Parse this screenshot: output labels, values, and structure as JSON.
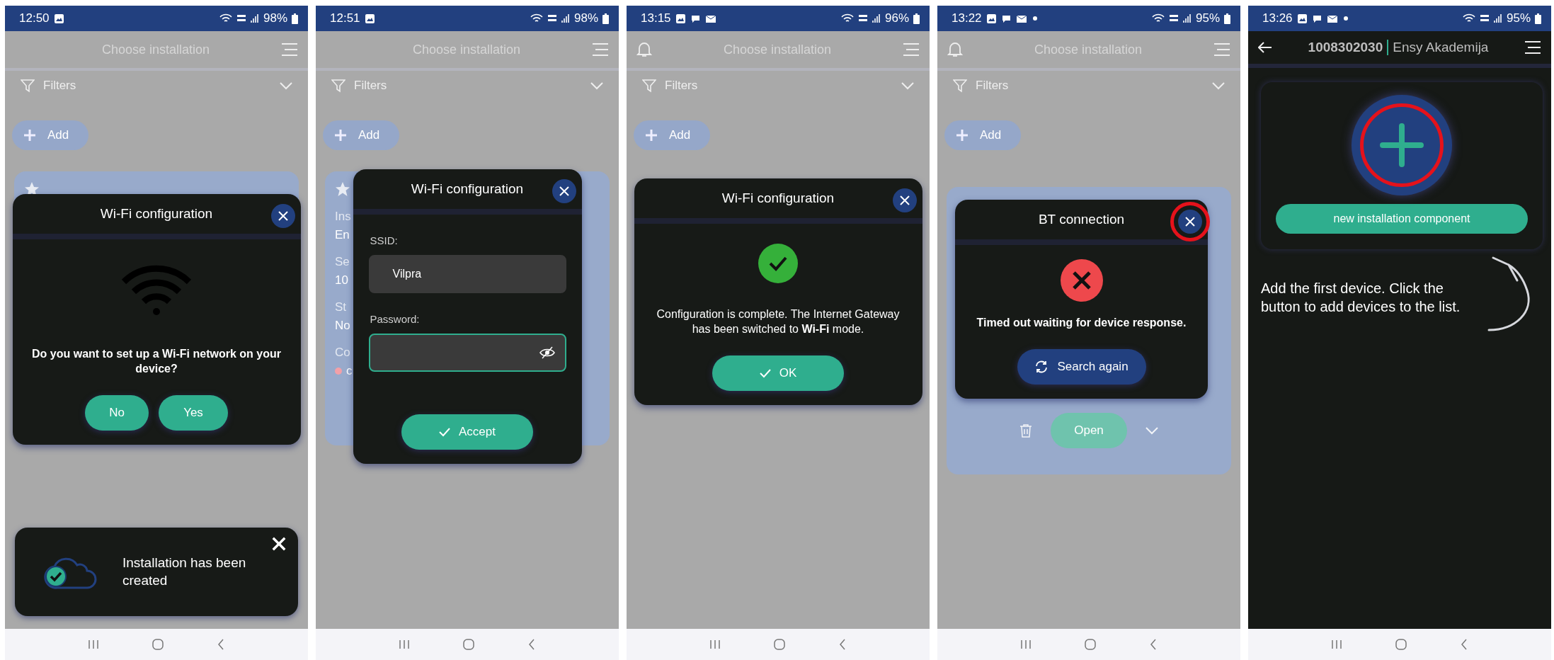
{
  "screens": [
    {
      "kind": "list",
      "status": {
        "time": "12:50",
        "icons": [
          {
            "kind": "image"
          }
        ],
        "battery": "98%"
      },
      "header": {
        "title": "Choose installation",
        "bell": false
      },
      "filters": {
        "label": "Filters"
      },
      "add": {
        "label": "Add"
      },
      "card": {
        "star": true
      },
      "dialog": {
        "kind": "question",
        "title": "Wi-Fi configuration",
        "close_highlighted": false,
        "message": "Do you want to set up a Wi-Fi network on your device?",
        "buttons": [
          "No",
          "Yes"
        ]
      },
      "toast": {
        "message": "Installation has been created"
      }
    },
    {
      "kind": "list",
      "status": {
        "time": "12:51",
        "icons": [
          {
            "kind": "image"
          }
        ],
        "battery": "98%"
      },
      "header": {
        "title": "Choose installation",
        "bell": false
      },
      "filters": {
        "label": "Filters"
      },
      "add": {
        "label": "Add"
      },
      "card": {
        "star": true,
        "fragments": [
          {
            "kind": "label",
            "text": "Ins"
          },
          {
            "kind": "value",
            "text": "En"
          },
          {
            "kind": "label",
            "text": "Se"
          },
          {
            "kind": "value",
            "text": "10"
          },
          {
            "kind": "label",
            "text": "St"
          },
          {
            "kind": "value",
            "text": "No"
          },
          {
            "kind": "label",
            "text": "Co"
          },
          {
            "kind": "status",
            "text": "c"
          }
        ]
      },
      "dialog": {
        "kind": "form",
        "title": "Wi-Fi configuration",
        "close_highlighted": false,
        "fields": [
          {
            "label": "SSID:",
            "value": "Vilpra",
            "focused": false
          },
          {
            "label": "Password:",
            "focused": true,
            "secret": true
          }
        ],
        "buttons": [
          "Accept"
        ]
      }
    },
    {
      "kind": "list",
      "status": {
        "time": "13:15",
        "icons": [
          {
            "kind": "image"
          },
          {
            "kind": "chat"
          },
          {
            "kind": "mail"
          }
        ],
        "battery": "96%"
      },
      "header": {
        "title": "Choose installation",
        "bell": true
      },
      "filters": {
        "label": "Filters"
      },
      "add": {
        "label": "Add"
      },
      "dialog": {
        "kind": "success",
        "title": "Wi-Fi configuration",
        "close_highlighted": false,
        "message": "Configuration is complete. The Internet Gateway has been switched to **Wi-Fi** mode.",
        "buttons": [
          "OK"
        ]
      }
    },
    {
      "kind": "list",
      "status": {
        "time": "13:22",
        "icons": [
          {
            "kind": "image"
          },
          {
            "kind": "chat"
          },
          {
            "kind": "mail"
          },
          {
            "kind": "dot"
          }
        ],
        "battery": "95%"
      },
      "header": {
        "title": "Choose installation",
        "bell": true
      },
      "filters": {
        "label": "Filters"
      },
      "add": {
        "label": "Add"
      },
      "card": {
        "open": "Open"
      },
      "dialog": {
        "kind": "error",
        "title": "BT connection",
        "close_highlighted": true,
        "message": "Timed out waiting for device response.",
        "buttons": [
          "Search again"
        ]
      }
    },
    {
      "kind": "installation",
      "status": {
        "time": "13:26",
        "icons": [
          {
            "kind": "image"
          },
          {
            "kind": "chat"
          },
          {
            "kind": "mail"
          },
          {
            "kind": "dot"
          }
        ],
        "battery": "95%"
      },
      "header": {
        "code": "1008302030",
        "name": "Ensy Akademija"
      },
      "component": {
        "button": "new installation component",
        "highlighted": true
      },
      "hint": "Add the first device. Click the button to add devices to the list."
    }
  ]
}
